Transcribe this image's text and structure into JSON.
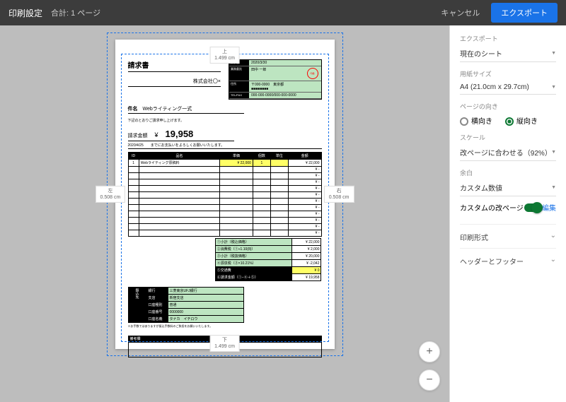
{
  "topbar": {
    "title": "印刷設定",
    "pages": "合計: 1 ページ",
    "cancel": "キャンセル",
    "export": "エクスポート"
  },
  "margins": {
    "top_lbl": "上",
    "top": "1.499 cm",
    "bottom_lbl": "下",
    "bottom": "1.499 cm",
    "left_lbl": "左",
    "left": "0.508 cm",
    "right_lbl": "右",
    "right": "0.508 cm"
  },
  "doc": {
    "title": "請求書",
    "company": "株式会社〇×",
    "info": {
      "date_k": "請求日",
      "date": "2020/3/30",
      "from_k": "業務委託",
      "from": "田中 一郎",
      "addr_k": "住所",
      "addr": "〒000-0000　東京都",
      "bld": "■■■■■■■■",
      "tel_k": "TEL/FAX",
      "tel": "000-000-0000/000-000-0000"
    },
    "subject_k": "件名",
    "subject": "Webライティング一式",
    "lead": "下記のとおりご請求申し上げます。",
    "amount_k": "請求金額",
    "yen": "¥",
    "amount": "19,958",
    "due": "2020/4/25　　までにお支払いをよろしくお願いいたします。",
    "th": {
      "id": "ID",
      "name": "品名",
      "unit": "単価",
      "qty": "個数",
      "u": "単位",
      "amt": "金額"
    },
    "item": {
      "id": "1",
      "name": "Webライティング原稿料",
      "unit": "22,000",
      "qty": "1",
      "amt": "22,000"
    },
    "sum": {
      "s1": "①小計（税込価格）",
      "v1": "22,000",
      "s2": "②消費税（①÷1.10(8)）",
      "v2": "2,000",
      "s3": "③小計（税抜価格）",
      "v3": "20,000",
      "s4": "④源泉税（③×10.21%）",
      "v4": "-2,042",
      "s5": "⑤交通費",
      "v5": "0",
      "s6": "⑥請求金額（①−④＋⑤）",
      "v6": "19,958"
    },
    "bank": {
      "k1": "銀行",
      "v1": "三菱東京UFJ銀行",
      "k2": "支店",
      "v2": "新宿支店",
      "k3": "口座種別",
      "v3": "普通",
      "k4": "口座番号",
      "v4": "0000000",
      "k5": "口座名義",
      "v5": "タナカ　イチロウ"
    },
    "bank_lbl": "振込先",
    "bank_note": "※お手数ではありますが振込手数料のご負担をお願いいたします。",
    "memo": "備考欄"
  },
  "panel": {
    "export_lbl": "エクスポート",
    "export_val": "現在のシート",
    "size_lbl": "用紙サイズ",
    "size_val": "A4 (21.0cm x 29.7cm)",
    "orient_lbl": "ページの向き",
    "landscape": "横向き",
    "portrait": "縦向き",
    "scale_lbl": "スケール",
    "scale_val": "改ページに合わせる（92%）",
    "margin_lbl": "余白",
    "margin_val": "カスタム数値",
    "custom_break": "カスタムの改ページ",
    "edit": "編集",
    "print_fmt": "印刷形式",
    "header_footer": "ヘッダーとフッター"
  }
}
